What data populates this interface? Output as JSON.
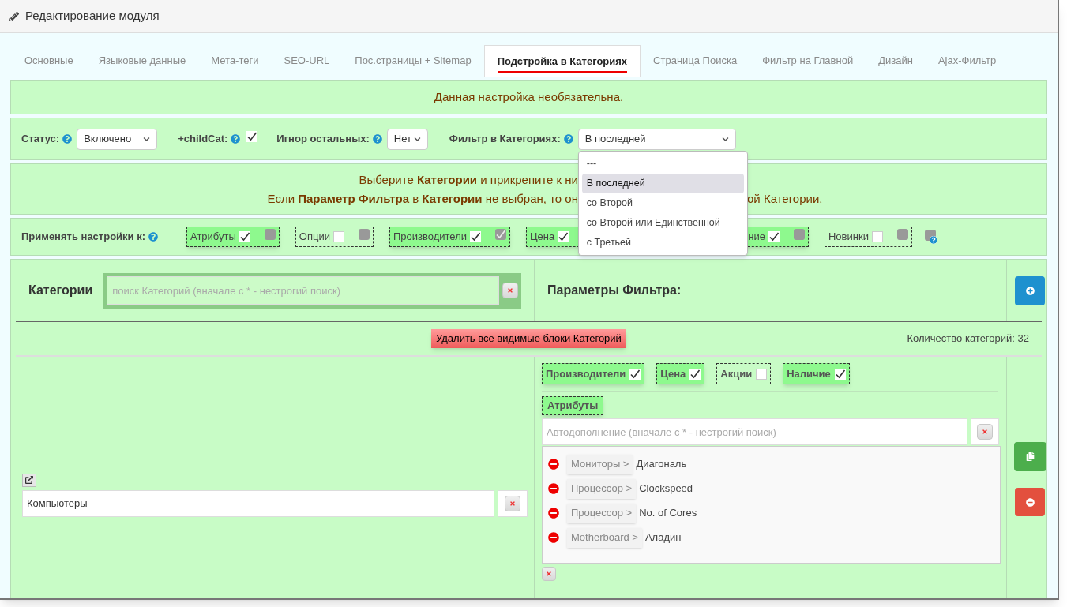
{
  "header": {
    "title": "Редактирование модуля"
  },
  "tabs": [
    {
      "label": "Основные",
      "selected": false
    },
    {
      "label": "Языковые данные",
      "selected": false
    },
    {
      "label": "Мета-теги",
      "selected": false
    },
    {
      "label": "SEO-URL",
      "selected": false
    },
    {
      "label": "Пос.страницы + Sitemap",
      "selected": false
    },
    {
      "label": "Подстройка в Категориях",
      "selected": true
    },
    {
      "label": "Страница Поиска",
      "selected": false
    },
    {
      "label": "Фильтр на Главной",
      "selected": false
    },
    {
      "label": "Дизайн",
      "selected": false
    },
    {
      "label": "Ajax-Фильтр",
      "selected": false
    }
  ],
  "notice": "Данная настройка необязательна.",
  "settings": {
    "status": {
      "label": "Статус:",
      "value": "Включено"
    },
    "child_cat": {
      "label": "+childCat:",
      "checked": true
    },
    "ignore_others": {
      "label": "Игнор остальных:",
      "value": "Нет"
    },
    "filter_in_categories": {
      "label": "Фильтр в Категориях:",
      "value": "В последней",
      "expanded": true,
      "options": [
        {
          "label": "---",
          "selected": false
        },
        {
          "label": "В последней",
          "selected": true
        },
        {
          "label": "со Второй",
          "selected": false
        },
        {
          "label": "со Второй или Единственной",
          "selected": false
        },
        {
          "label": "с Третьей",
          "selected": false
        }
      ]
    }
  },
  "info": {
    "line_1": "Выберите **Категории** и прикрепите к ни",
    "line_2_start": "Если **Параметр Фильтра** в **Категории** не выбран, то он",
    "line_2_end": "ой Категории."
  },
  "apply": {
    "label": "Применять настройки к:",
    "items": [
      {
        "label": "Атрибуты",
        "checked": true,
        "strict": false
      },
      {
        "label": "Опции",
        "checked": false,
        "strict": false
      },
      {
        "label": "Производители",
        "checked": true,
        "strict": true
      },
      {
        "label": "Цена",
        "checked": true
      },
      {
        "label": "ние",
        "checked": true,
        "strict": false
      },
      {
        "label": "Новинки",
        "checked": false,
        "strict": false
      }
    ]
  },
  "categories": {
    "title": "Категории",
    "search_placeholder": "поиск Категорий (вначале с * - нестрогий поиск)",
    "params_title": "Параметры Фильтра:",
    "delete_all": "Удалить все видимые блоки Категорий",
    "count": "Количество категорий: 32",
    "block": {
      "category": "Компьютеры",
      "params": [
        {
          "label": "Производители",
          "checked": true
        },
        {
          "label": "Цена",
          "checked": true
        },
        {
          "label": "Акции",
          "checked": false
        },
        {
          "label": "Наличие",
          "checked": true
        }
      ],
      "attributes_label": "Атрибуты",
      "autocomplete_placeholder": "Автодополнение (вначале с * - нестрогий поиск)",
      "attributes": [
        {
          "group": "Мониторы >",
          "name": "Диагональ"
        },
        {
          "group": "Процессор >",
          "name": "Clockspeed"
        },
        {
          "group": "Процессор >",
          "name": "No. of Cores"
        },
        {
          "group": "Motherboard >",
          "name": "Аладин"
        }
      ]
    }
  }
}
